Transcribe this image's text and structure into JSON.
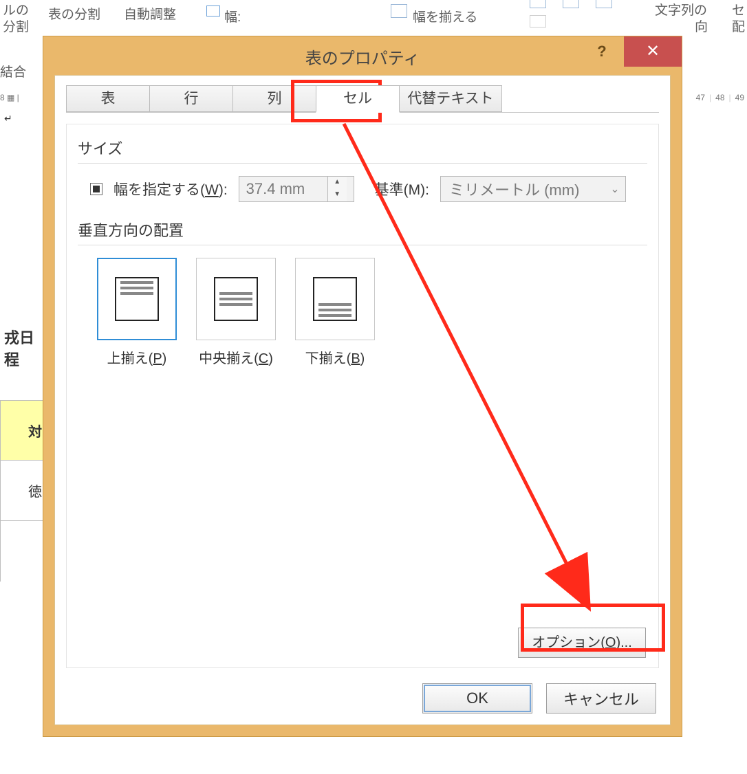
{
  "ribbon": {
    "cell_of": "ルの",
    "split": "分割",
    "merge": "結合",
    "table_split": "表の分割",
    "autofit": "自動調整",
    "width_label": "幅:",
    "align_width": "幅を揃える",
    "text_of": "文字列の",
    "dir": "向",
    "se": "セ",
    "hai": "配"
  },
  "ruler": {
    "left": "8  ▦  | ",
    "r47": "47",
    "r48": "48",
    "r49": "49"
  },
  "docback": {
    "schedule": "戎日程",
    "target": "対",
    "toku": "徳",
    "para": "↵"
  },
  "dialog": {
    "title": "表のプロパティ",
    "tabs": {
      "table": "表",
      "row": "行",
      "col": "列",
      "cell": "セル",
      "alt": "代替テキスト"
    },
    "size_section": "サイズ",
    "width_check": "幅を指定する(<u>W</u>):",
    "width_value": "37.4 mm",
    "base_label": "基準(M):",
    "base_value": "ミリメートル (mm)",
    "valign_section": "垂直方向の配置",
    "valign": {
      "top": "上揃え(<u>P</u>)",
      "center": "中央揃え(<u>C</u>)",
      "bottom": "下揃え(<u>B</u>)"
    },
    "options_btn": "オプション(<u>O</u>)...",
    "ok": "OK",
    "cancel": "キャンセル"
  }
}
